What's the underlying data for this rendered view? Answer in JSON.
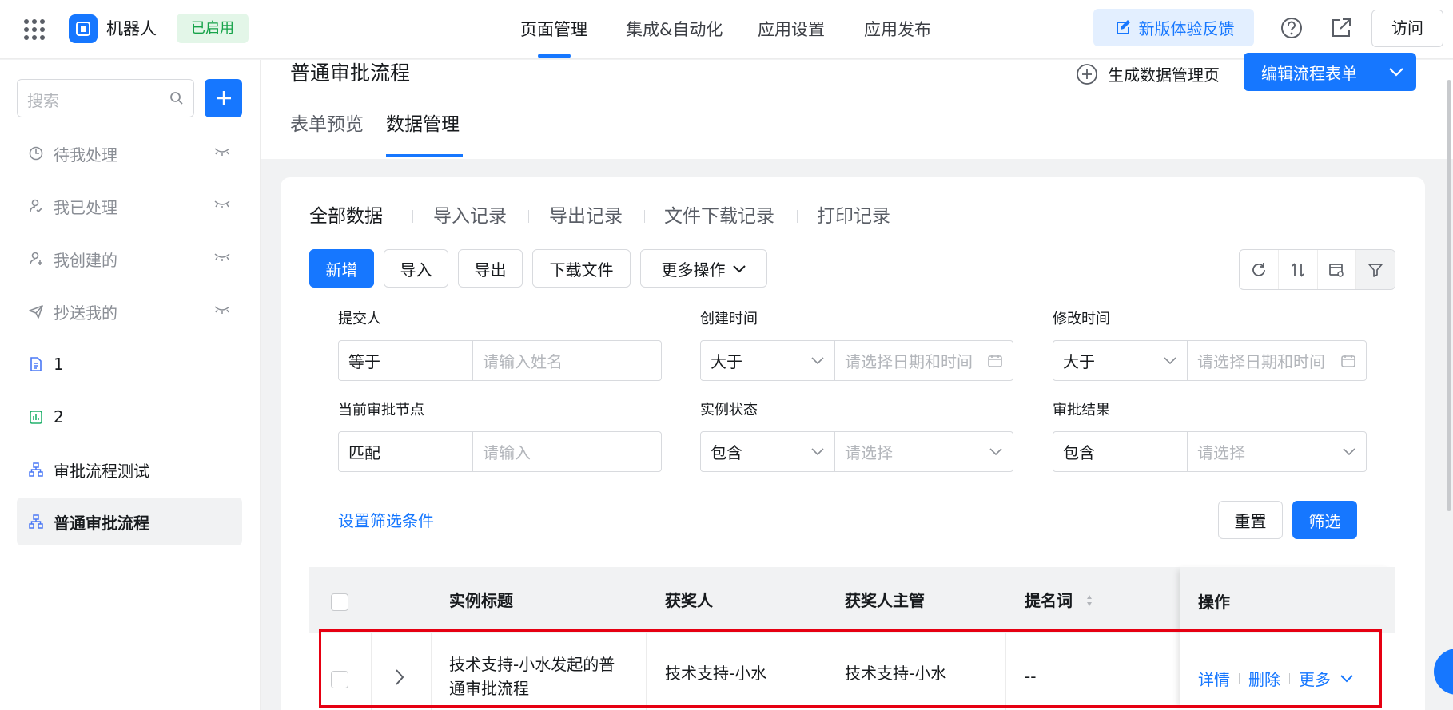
{
  "topbar": {
    "app_name": "机器人",
    "status_badge": "已启用",
    "nav": [
      "页面管理",
      "集成&自动化",
      "应用设置",
      "应用发布"
    ],
    "feedback_label": "新版体验反馈",
    "visit_label": "访问"
  },
  "sidebar": {
    "search_placeholder": "搜索",
    "items": [
      {
        "label": "待我处理",
        "icon": "clock-icon"
      },
      {
        "label": "我已处理",
        "icon": "user-check-icon"
      },
      {
        "label": "我创建的",
        "icon": "user-add-icon"
      },
      {
        "label": "抄送我的",
        "icon": "send-icon"
      },
      {
        "label": "1",
        "icon": "document-icon"
      },
      {
        "label": "2",
        "icon": "chart-icon"
      },
      {
        "label": "审批流程测试",
        "icon": "flow-icon"
      },
      {
        "label": "普通审批流程",
        "icon": "flow-icon"
      }
    ]
  },
  "page": {
    "title": "普通审批流程",
    "generate_label": "生成数据管理页",
    "edit_label": "编辑流程表单",
    "tabs": [
      "表单预览",
      "数据管理"
    ]
  },
  "data_tabs": [
    "全部数据",
    "导入记录",
    "导出记录",
    "文件下载记录",
    "打印记录"
  ],
  "toolbar": {
    "add": "新增",
    "import": "导入",
    "export": "导出",
    "download": "下载文件",
    "more": "更多操作"
  },
  "filters": [
    {
      "label": "提交人",
      "op": "等于",
      "placeholder": "请输入姓名"
    },
    {
      "label": "创建时间",
      "op": "大于",
      "placeholder": "请选择日期和时间"
    },
    {
      "label": "修改时间",
      "op": "大于",
      "placeholder": "请选择日期和时间"
    },
    {
      "label": "当前审批节点",
      "op": "匹配",
      "placeholder": "请输入"
    },
    {
      "label": "实例状态",
      "op": "包含",
      "placeholder": "请选择"
    },
    {
      "label": "审批结果",
      "op": "包含",
      "placeholder": "请选择"
    }
  ],
  "filter_actions": {
    "set": "设置筛选条件",
    "reset": "重置",
    "apply": "筛选"
  },
  "table": {
    "headers": [
      "实例标题",
      "获奖人",
      "获奖人主管",
      "提名词",
      "操作"
    ],
    "rows": [
      {
        "title_line1": "技术支持-小水发起的普",
        "title_line2": "通审批流程",
        "winner": "技术支持-小水",
        "manager": "技术支持-小水",
        "nomination": "--",
        "actions": [
          "详情",
          "删除",
          "更多"
        ]
      }
    ]
  },
  "colors": {
    "accent": "#1677ff",
    "highlight": "#e60012",
    "badge": "#17a34a"
  }
}
